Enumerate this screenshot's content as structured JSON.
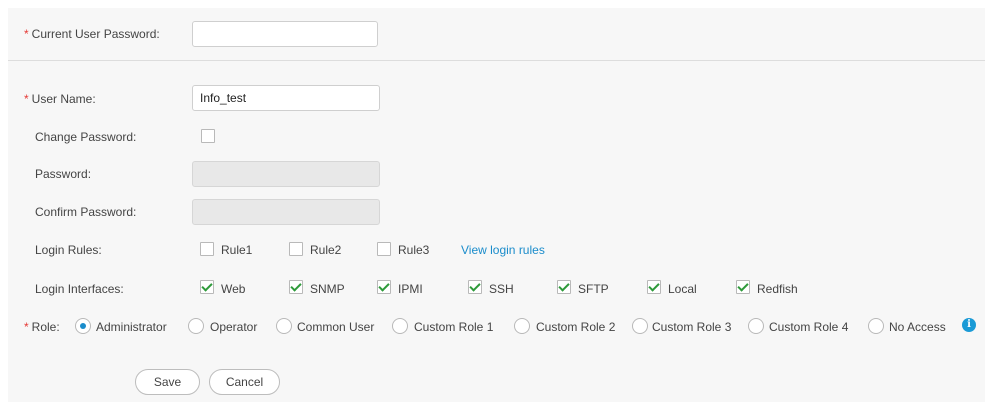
{
  "form": {
    "current_password_label": "Current User Password:",
    "current_password_value": "",
    "user_name_label": "User Name:",
    "user_name_value": "Info_test",
    "change_password_label": "Change Password:",
    "change_password_checked": false,
    "password_label": "Password:",
    "confirm_password_label": "Confirm Password:",
    "login_rules_label": "Login Rules:",
    "login_rules": [
      {
        "label": "Rule1",
        "checked": false
      },
      {
        "label": "Rule2",
        "checked": false
      },
      {
        "label": "Rule3",
        "checked": false
      }
    ],
    "view_login_rules_link": "View login rules",
    "login_interfaces_label": "Login Interfaces:",
    "login_interfaces": [
      {
        "label": "Web",
        "checked": true
      },
      {
        "label": "SNMP",
        "checked": true
      },
      {
        "label": "IPMI",
        "checked": true
      },
      {
        "label": "SSH",
        "checked": true
      },
      {
        "label": "SFTP",
        "checked": true
      },
      {
        "label": "Local",
        "checked": true
      },
      {
        "label": "Redfish",
        "checked": true
      }
    ],
    "role_label": "Role:",
    "roles": [
      {
        "label": "Administrator",
        "selected": true
      },
      {
        "label": "Operator",
        "selected": false
      },
      {
        "label": "Common User",
        "selected": false
      },
      {
        "label": "Custom Role 1",
        "selected": false
      },
      {
        "label": "Custom Role 2",
        "selected": false
      },
      {
        "label": "Custom Role 3",
        "selected": false
      },
      {
        "label": "Custom Role 4",
        "selected": false
      },
      {
        "label": "No Access",
        "selected": false
      }
    ],
    "required_mark": "*",
    "info_icon": "info-icon",
    "info_glyph": "i"
  },
  "actions": {
    "save_label": "Save",
    "cancel_label": "Cancel"
  },
  "colors": {
    "required": "#e53935",
    "accent": "#1a8ccb",
    "check": "#2e9a3a"
  }
}
